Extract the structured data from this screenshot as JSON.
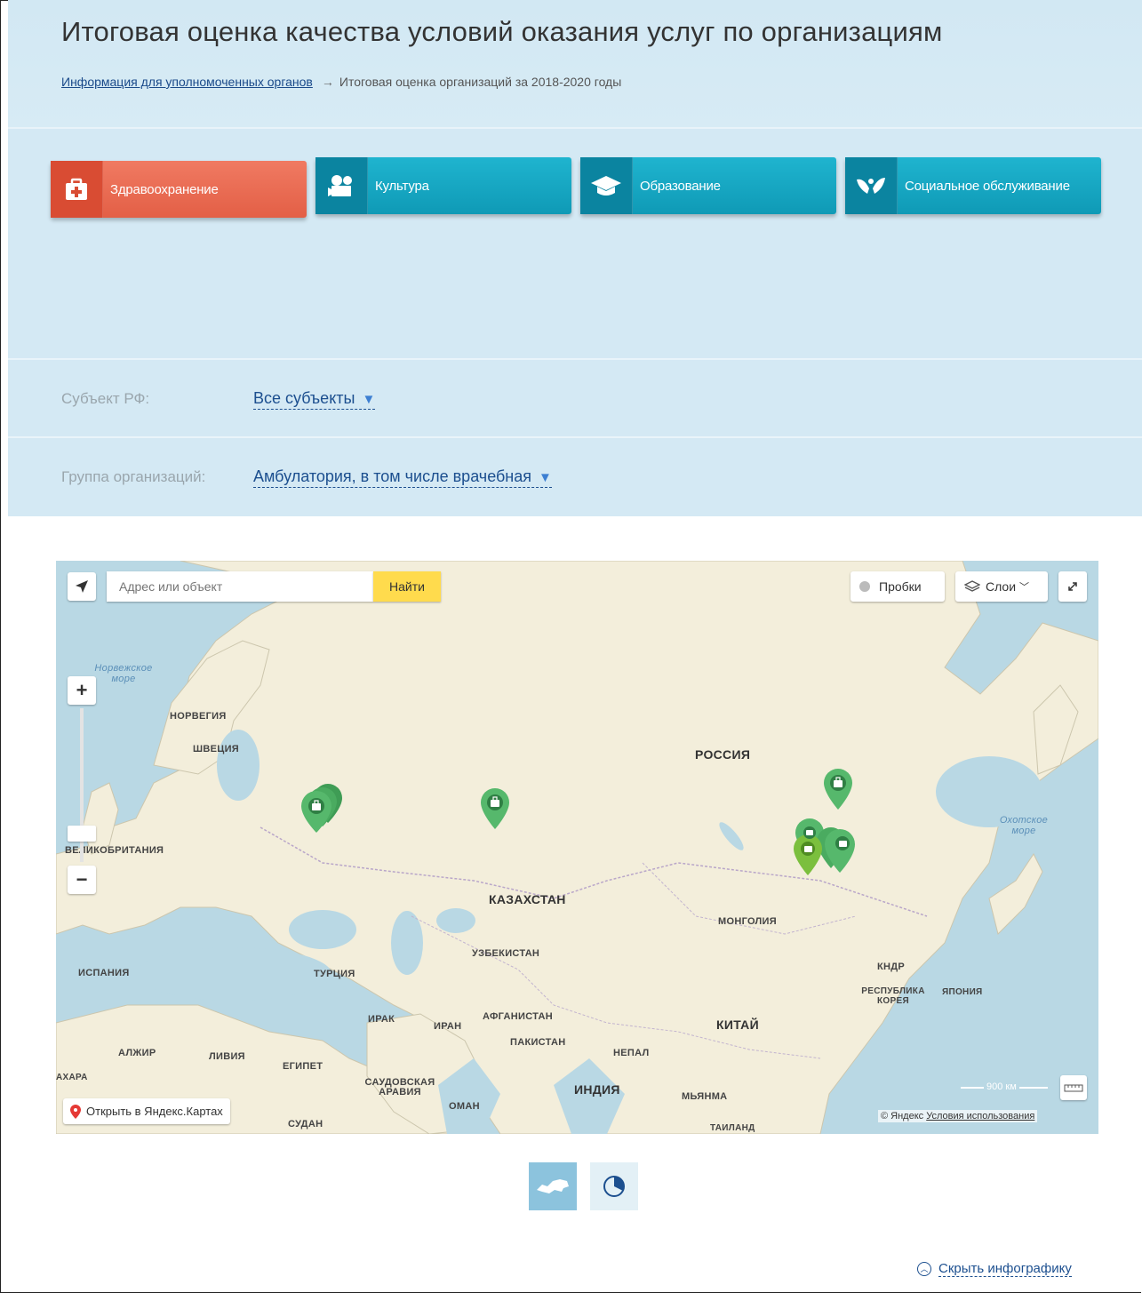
{
  "header": {
    "title": "Итоговая оценка качества условий оказания услуг по организациям",
    "breadcrumb_link": "Информация для уполномоченных органов",
    "breadcrumb_current": "Итоговая оценка организаций за 2018-2020 годы"
  },
  "sectors": [
    {
      "label": "Здравоохранение",
      "icon": "medkit-icon",
      "active": true,
      "color": "#e8654c"
    },
    {
      "label": "Культура",
      "icon": "theater-camera-icon",
      "active": false,
      "color": "#16a8c4"
    },
    {
      "label": "Образование",
      "icon": "graduation-cap-icon",
      "active": false,
      "color": "#16a8c4"
    },
    {
      "label": "Социальное обслуживание",
      "icon": "hands-heart-icon",
      "active": false,
      "color": "#16a8c4"
    }
  ],
  "filters": {
    "subject": {
      "label": "Субъект РФ:",
      "value": "Все субъекты"
    },
    "group": {
      "label": "Группа организаций:",
      "value": "Амбулатория, в том числе врачебная"
    }
  },
  "map": {
    "search_placeholder": "Адрес или объект",
    "find_button": "Найти",
    "traffic_button": "Пробки",
    "layers_button": "Слои",
    "open_in_yandex": "Открыть в Яндекс.Картах",
    "scale": "900 км",
    "copyright": "© Яндекс",
    "terms": "Условия использования",
    "labels": {
      "russia": "РОССИЯ",
      "kazakhstan": "КАЗАХСТАН",
      "mongolia": "МОНГОЛИЯ",
      "china": "КИТАЙ",
      "india": "ИНДИЯ",
      "norway": "НОРВЕГИЯ",
      "sweden": "ШВЕЦИЯ",
      "uk": "ВЕЛИКОБРИТАНИЯ",
      "spain": "ИСПАНИЯ",
      "turkey": "ТУРЦИЯ",
      "uzbekistan": "УЗБЕКИСТАН",
      "iraq": "ИРАК",
      "iran": "ИРАН",
      "afghanistan": "АФГАНИСТАН",
      "pakistan": "ПАКИСТАН",
      "nepal": "НЕПАЛ",
      "myanmar": "МЬЯНМА",
      "algeria": "АЛЖИР",
      "libya": "ЛИВИЯ",
      "egypt": "ЕГИПЕТ",
      "saudi": "САУДОВСКАЯ АРАВИЯ",
      "oman": "ОМАН",
      "sudan": "СУДАН",
      "dprk": "КНДР",
      "korea": "РЕСПУБЛИКА КОРЕЯ",
      "japan": "ЯПОНИЯ",
      "thailand": "ТАИЛАНД",
      "sahara": "АХАРА",
      "norwegian_sea": "Норвежское море",
      "okhotsk_sea": "Охотское море"
    }
  },
  "view_switch": {
    "map_icon": "russia-map-icon",
    "pie_icon": "pie-chart-icon"
  },
  "hide_infographic": "Скрыть инфографику",
  "colors": {
    "accent_red": "#e8654c",
    "accent_teal": "#16a8c4",
    "marker_green": "#4caf63",
    "link_blue": "#1c4f8f"
  }
}
